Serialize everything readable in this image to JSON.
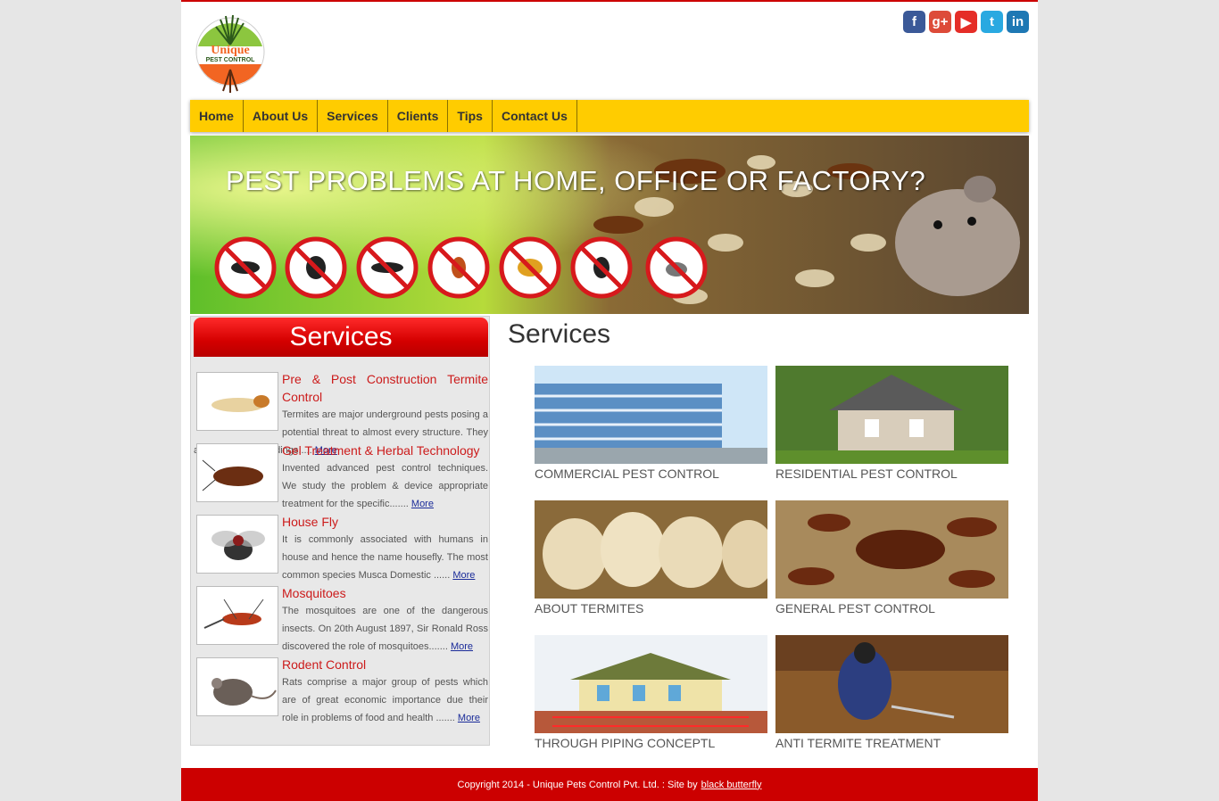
{
  "brand": {
    "logo_text": "Unique",
    "logo_sub": "PEST CONTROL"
  },
  "social": [
    {
      "icon": "facebook-icon",
      "glyph": "f",
      "color": "#3b5998"
    },
    {
      "icon": "google-plus-icon",
      "glyph": "g+",
      "color": "#dd4b39"
    },
    {
      "icon": "youtube-icon",
      "glyph": "▶",
      "color": "#e52d27"
    },
    {
      "icon": "twitter-icon",
      "glyph": "t",
      "color": "#29a9e1"
    },
    {
      "icon": "linkedin-icon",
      "glyph": "in",
      "color": "#1e78b4"
    }
  ],
  "nav": [
    {
      "label": "Home"
    },
    {
      "label": "About Us"
    },
    {
      "label": "Services"
    },
    {
      "label": "Clients"
    },
    {
      "label": "Tips"
    },
    {
      "label": "Contact Us"
    }
  ],
  "banner": {
    "title": "PEST PROBLEMS AT HOME, OFFICE OR FACTORY?"
  },
  "sidebar": {
    "heading": "Services",
    "more_label": "More",
    "items": [
      {
        "title": "Pre & Post Construction Termite Control",
        "body": "Termites are major underground pests posing a potential threat to almost every structure. They attack not only buildings.....",
        "thumb": "termite"
      },
      {
        "title": "Gel Treatment & Herbal Technology",
        "body": "Invented advanced pest control techniques. We study the problem & device appropriate treatment for the specific.......",
        "thumb": "cockroach"
      },
      {
        "title": "House Fly",
        "body": "It is commonly associated with humans in house and hence the name housefly. The most common species Musca Domestic ......",
        "thumb": "fly"
      },
      {
        "title": "Mosquitoes",
        "body": "The mosquitoes are one of the dangerous insects. On 20th August 1897, Sir Ronald Ross discovered the role of mosquitoes.......",
        "thumb": "mosquito"
      },
      {
        "title": "Rodent Control",
        "body": "Rats comprise a major group of pests which are of great economic importance due their role in problems of food and health .......",
        "thumb": "rat"
      }
    ]
  },
  "main": {
    "title": "Services",
    "cards": [
      {
        "caption": "COMMERCIAL PEST CONTROL",
        "scene": "building"
      },
      {
        "caption": "RESIDENTIAL PEST CONTROL",
        "scene": "house"
      },
      {
        "caption": "ABOUT TERMITES",
        "scene": "termites"
      },
      {
        "caption": "GENERAL PEST CONTROL",
        "scene": "roaches"
      },
      {
        "caption": "THROUGH PIPING CONCEPTL",
        "scene": "piping"
      },
      {
        "caption": "ANTI TERMITE TREATMENT",
        "scene": "worker"
      }
    ]
  },
  "footer": {
    "text": "Copyright 2014 - Unique Pets Control Pvt. Ltd. : Site by",
    "link": "black butterfly"
  }
}
